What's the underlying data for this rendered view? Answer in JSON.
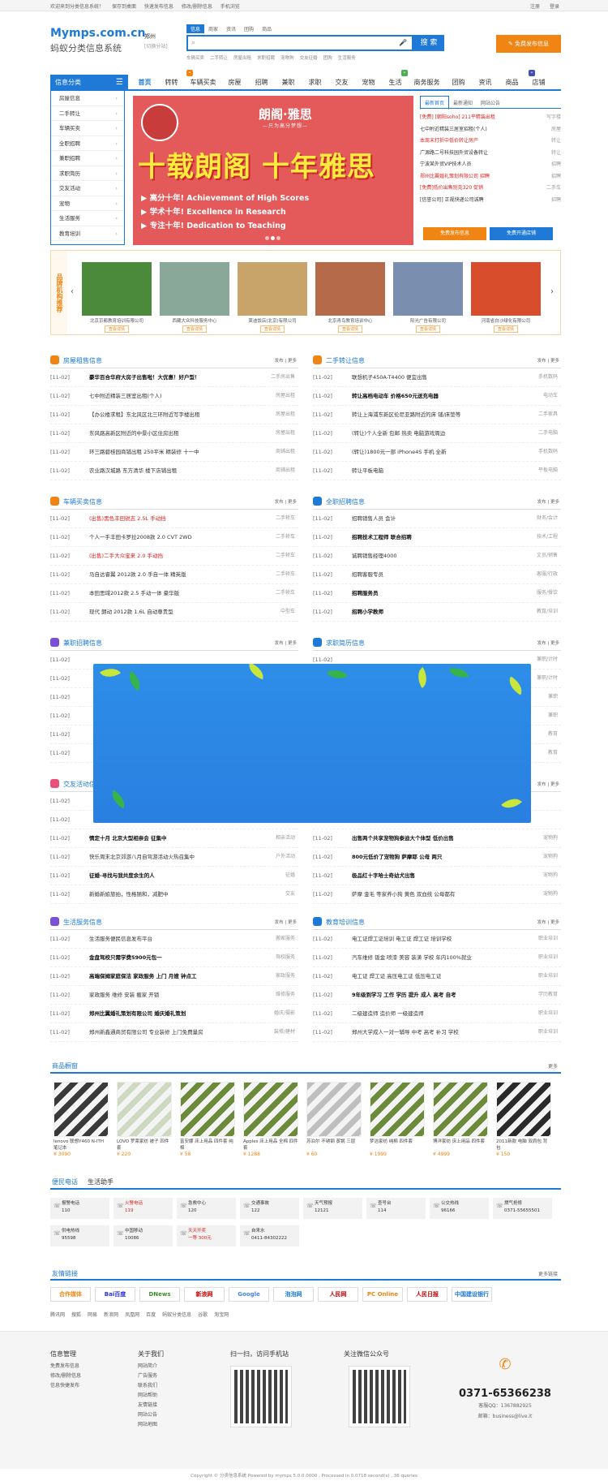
{
  "topbar": {
    "welcome": "欢迎来到分类信息系统！",
    "links": [
      "保存到桌面",
      "快速发布信息",
      "修改/删除信息",
      "手机浏览"
    ],
    "right": [
      "注册",
      "登录"
    ]
  },
  "header": {
    "logo_en": "Mymps.com.cn",
    "logo_cn": "蚂蚁分类信息系统",
    "city": "郑州",
    "city_switch": "[切换分站]",
    "search_tabs": [
      "信息",
      "商家",
      "资讯",
      "团购",
      "商品"
    ],
    "search_placeholder": "",
    "search_button": "搜 索",
    "hot": [
      "车辆买卖",
      "二手转让",
      "房屋出租",
      "求职招聘",
      "宠物狗",
      "交友征婚",
      "团购",
      "生活服务"
    ],
    "post_button": "免费发布信息"
  },
  "nav": {
    "category_title": "信息分类",
    "items": [
      "首页",
      "转转",
      "车辆买卖",
      "房屋",
      "招聘",
      "兼职",
      "求职",
      "交友",
      "宠物",
      "生活",
      "商务服务",
      "团购",
      "资讯",
      "商品",
      "店铺"
    ]
  },
  "side": [
    "房屋信息",
    "二手转让",
    "车辆买卖",
    "全职招聘",
    "兼职招聘",
    "求职简历",
    "交友活动",
    "宠物",
    "生活服务",
    "教育培训"
  ],
  "banner": {
    "brand": "朗阁·雅思",
    "motto": "—只为高分梦想—",
    "big": "十载朗阁 十年雅思",
    "lines": [
      "▶ 高分十年! Achievement of High Scores",
      "▶ 学术十年! Excellence in Research",
      "▶ 专注十年! Dedication to Teaching"
    ]
  },
  "news": {
    "tabs": [
      "最新首页",
      "最新通知",
      "网站公告"
    ],
    "items": [
      {
        "t": "[免费] [朝阳soho] 211平精装出租",
        "c": "写字楼",
        "red": true
      },
      {
        "t": "七中附近精装三居室招租(个人)",
        "c": "房屋",
        "red": false
      },
      {
        "t": "本周末打折中低价转让房产",
        "c": "转让",
        "red": true
      },
      {
        "t": "广源路二号科技园外贸设备转让",
        "c": "转让",
        "red": false
      },
      {
        "t": "宁波某外贸VIP技术人员",
        "c": "招聘",
        "red": false
      },
      {
        "t": "郑州比翼婚礼策划有限公司 招聘",
        "c": "招聘",
        "red": true
      },
      {
        "t": "[免费]低价出售别克320 促销",
        "c": "二手车",
        "red": true
      },
      {
        "t": "[信誉公司] 正规快递公司诚聘",
        "c": "招聘",
        "red": false
      }
    ],
    "btn1": "免费发布信息",
    "btn2": "免费开通店铺"
  },
  "brands": {
    "label": "品牌机构推荐",
    "items": [
      "北京京都教育培训有限公司",
      "西藏大众科技服务中心",
      "莱迪饭店(北京)有限公司",
      "北京青鸟教育培训中心",
      "阳光广告有限公司",
      "河南省白沙绿化有限公司"
    ],
    "btn": "查看详情"
  },
  "sections": [
    {
      "title": "房屋租售信息",
      "more": "发布 | 更多",
      "color": "#f08513",
      "rows": [
        [
          "[11-02]",
          "豪华百合华府大房子出售啦！大优惠！好户型！",
          "二手房出售",
          true,
          false
        ],
        [
          "[11-02]",
          "七中附近精装三居室出租(个人)",
          "房屋出租",
          false,
          false
        ],
        [
          "[11-02]",
          "【办公楼求租】东北风区北三环附近写字楼出租",
          "房屋出租",
          false,
          false
        ],
        [
          "[11-02]",
          "东风路高新区附近的中景小区住房出租",
          "房屋出租",
          false,
          false
        ],
        [
          "[11-02]",
          "环三路碧桂园商铺出租 250平米 精装修 十一中",
          "商铺出租",
          false,
          false
        ],
        [
          "[11-02]",
          "农业路汉城路 东方清华 楼下店铺出租",
          "商铺出租",
          false,
          false
        ]
      ]
    },
    {
      "title": "二手转让信息",
      "more": "发布 | 更多",
      "color": "#f08513",
      "rows": [
        [
          "[11-02]",
          "联想机子450A-T4400 便宜出售",
          "手机数码",
          false,
          false
        ],
        [
          "[11-02]",
          "转让高档电动车 价格650元送充电器",
          "电动车",
          true,
          true
        ],
        [
          "[11-02]",
          "转让上海浦东新区伦尼亚路附近的床 铺/床垫等",
          "二手家具",
          false,
          false
        ],
        [
          "[11-02]",
          "(转让)个人全新 包邮 热卖 电脑游戏周边",
          "二手电脑",
          false,
          false
        ],
        [
          "[11-02]",
          "(转让)1800元一部 iPhone4S 手机 全新",
          "手机数码",
          false,
          false
        ],
        [
          "[11-02]",
          "转让平板电脑",
          "平板电脑",
          false,
          false
        ]
      ]
    },
    {
      "title": "车辆买卖信息",
      "more": "发布 | 更多",
      "color": "#f08513",
      "rows": [
        [
          "[11-02]",
          "(出售)黑色丰田锐志 2.5L 手动挡",
          "二手轿车",
          false,
          true
        ],
        [
          "[11-02]",
          "个人一手丰田卡罗拉2008款 2.0 CVT 2WD",
          "二手轿车",
          false,
          false
        ],
        [
          "[11-02]",
          "(出售)二手大众宝来 2.0 手动挡",
          "二手轿车",
          false,
          true
        ],
        [
          "[11-02]",
          "马自达睿翼 2012款 2.0 手自一体 精英版",
          "二手轿车",
          false,
          false
        ],
        [
          "[11-02]",
          "本田思域2012款 2.5 手动一体 豪华版",
          "二手轿车",
          false,
          false
        ],
        [
          "[11-02]",
          "现代 朗动 2012款 1.6L 自动尊贵型",
          "中型车",
          false,
          false
        ]
      ]
    },
    {
      "title": "全职招聘信息",
      "more": "发布 | 更多",
      "color": "#1e7ad6",
      "rows": [
        [
          "[11-02]",
          "招聘销售人员 会计",
          "财务/会计",
          false,
          false
        ],
        [
          "[11-02]",
          "招聘技术工程师 联合招聘",
          "技术/工程",
          true,
          true
        ],
        [
          "[11-02]",
          "诚聘销售经理4000",
          "文员/销售",
          false,
          false
        ],
        [
          "[11-02]",
          "招聘客服专员",
          "客服/行政",
          false,
          false
        ],
        [
          "[11-02]",
          "招聘服务员",
          "服务/餐饮",
          true,
          true
        ],
        [
          "[11-02]",
          "招聘小学教师",
          "教育/培训",
          true,
          true
        ]
      ]
    },
    {
      "title": "兼职招聘信息",
      "more": "发布 | 更多",
      "color": "#7b4fd6",
      "rows": [
        [
          "[11-02]",
          "",
          "",
          false,
          false
        ],
        [
          "[11-02]",
          "",
          "",
          false,
          false
        ],
        [
          "[11-02]",
          "",
          "",
          false,
          false
        ],
        [
          "[11-02]",
          "",
          "",
          false,
          false
        ],
        [
          "[11-02]",
          "",
          "",
          false,
          false
        ],
        [
          "[11-02]",
          "",
          "",
          false,
          false
        ]
      ]
    },
    {
      "title": "求职简历信息",
      "more": "发布 | 更多",
      "color": "#1e7ad6",
      "rows": [
        [
          "[11-02]",
          "",
          "兼职/计时",
          false,
          false
        ],
        [
          "[11-02]",
          "",
          "兼职/计时",
          false,
          false
        ],
        [
          "[11-02]",
          "",
          "兼职",
          false,
          false
        ],
        [
          "[11-02]",
          "",
          "兼职",
          false,
          false
        ],
        [
          "[11-02]",
          "",
          "教育",
          false,
          false
        ],
        [
          "[11-02]",
          "",
          "教育",
          false,
          false
        ]
      ]
    },
    {
      "title": "交友活动信息",
      "more": "发布 | 更多",
      "color": "#e8507a",
      "rows": [
        [
          "[11-02]",
          "",
          "",
          false,
          false
        ],
        [
          "[11-02]",
          "",
          "",
          false,
          false
        ],
        [
          "[11-02]",
          "情定十月 北京大型相亲会 征集中",
          "相亲活动",
          true,
          false
        ],
        [
          "[11-02]",
          "快乐周末北京郊游八月自驾游活动火热召集中",
          "户外活动",
          false,
          false
        ],
        [
          "[11-02]",
          "征婚-寻找与我共度余生的人",
          "征婚",
          true,
          false
        ],
        [
          "[11-02]",
          "新婚新娘旅拍，性格随和，减肥中",
          "交友",
          false,
          false
        ]
      ]
    },
    {
      "title": "",
      "more": "发布 | 更多",
      "color": "#1e7ad6",
      "rows": [
        [
          "[11-02]",
          "",
          "",
          false,
          false
        ],
        [
          "[11-02]",
          "",
          "",
          false,
          false
        ],
        [
          "[11-02]",
          "出售两个共享宠物狗泰迪大个体型 低价出售",
          "宠物狗",
          true,
          true
        ],
        [
          "[11-02]",
          "800元低价了宠物狗 萨摩耶 公母 两只",
          "宠物狗",
          true,
          false
        ],
        [
          "[11-02]",
          "极品红十字哈士奇幼犬出售",
          "宠物狗",
          true,
          true
        ],
        [
          "[11-02]",
          "萨摩 金毛 等家养小狗 黄色 双血统 公母都有",
          "宠物狗",
          false,
          false
        ]
      ]
    },
    {
      "title": "生活服务信息",
      "more": "发布 | 更多",
      "color": "#7b4fd6",
      "rows": [
        [
          "[11-02]",
          "生活服务便民信息发布平台",
          "搬家服务",
          false,
          false
        ],
        [
          "[11-02]",
          "金盘驾校只需学费5900元包一",
          "驾校服务",
          true,
          false
        ],
        [
          "[11-02]",
          "高端保姆家庭保洁 家政服务 上门 月嫂 钟点工",
          "家政服务",
          true,
          false
        ],
        [
          "[11-02]",
          "家政服务 维修 安装 搬家 开锁",
          "维修服务",
          false,
          false
        ],
        [
          "[11-02]",
          "郑州比翼婚礼策划有限公司 婚庆婚礼策划",
          "婚庆/摄影",
          true,
          true
        ],
        [
          "[11-02]",
          "郑州新鑫通商贸有限公司 专业装修 上门免费量房",
          "装修/建材",
          false,
          false
        ]
      ]
    },
    {
      "title": "教育培训信息",
      "more": "发布 | 更多",
      "color": "#1e7ad6",
      "rows": [
        [
          "[11-02]",
          "电工证焊工证培训 电工证 焊工证 培训学校",
          "职业培训",
          false,
          false
        ],
        [
          "[11-02]",
          "汽车维修 钣金 喷漆 美容 装潢 学校 年内100%就业",
          "职业培训",
          false,
          false
        ],
        [
          "[11-02]",
          "电工证 焊工证 高压电工证 低压电工证",
          "职业培训",
          false,
          false
        ],
        [
          "[11-02]",
          "9年级到学习 工作 学历 提升 成人 高考 自考",
          "学历教育",
          true,
          false
        ],
        [
          "[11-02]",
          "二级建造师 造价师 一级建造师",
          "职业培训",
          false,
          false
        ],
        [
          "[11-02]",
          "郑州大学成人一对一辅导 中考 高考 补习 学校",
          "职业培训",
          false,
          false
        ]
      ]
    }
  ],
  "goods": {
    "title": "商品橱窗",
    "more": "更多",
    "items": [
      {
        "n": "lenovo 联想Y460 N-ITH 笔记本",
        "p": "¥ 3090"
      },
      {
        "n": "LOVO 罗莱家纺 被子 四件套",
        "p": "¥ 220"
      },
      {
        "n": "富安娜 床上用品 四件套 纯棉",
        "p": "¥ 58"
      },
      {
        "n": "Apples 床上用品 全棉 四件套",
        "p": "¥ 1288"
      },
      {
        "n": "苏泊尔 不锈钢 蒸锅 三层",
        "p": "¥ 60"
      },
      {
        "n": "梦洁家纺 纯棉 四件套",
        "p": "¥ 1999"
      },
      {
        "n": "博洋家纺 床上用品 四件套",
        "p": "¥ 4999"
      },
      {
        "n": "2011新款 电脑 双肩包 背包",
        "p": "¥ 150"
      }
    ]
  },
  "contacts": {
    "tabs": [
      "便民电话",
      "生活助手"
    ],
    "items": [
      {
        "a": "报警电话",
        "b": "110"
      },
      {
        "a": "火警电话",
        "b": "119"
      },
      {
        "a": "急救中心",
        "b": "120"
      },
      {
        "a": "交通事故",
        "b": "122"
      },
      {
        "a": "天气预报",
        "b": "12121"
      },
      {
        "a": "查号台",
        "b": "114"
      },
      {
        "a": "公交热线",
        "b": "96166"
      },
      {
        "a": "燃气抢修",
        "b": "0371-55655501"
      },
      {
        "a": "供电热线",
        "b": "95598"
      },
      {
        "a": "中国移动",
        "b": "10086"
      },
      {
        "a": "天天开奖",
        "b": "一等 300元"
      },
      {
        "a": "自来水",
        "b": "0411-84302222"
      }
    ]
  },
  "links": {
    "title": "友情链接",
    "more": "更多链接",
    "logos": [
      "合作媒体",
      "Bai百度",
      "DNews",
      "新浪网",
      "Google",
      "泡泡网",
      "人民网",
      "PC Online",
      "人民日报",
      "中国建设银行"
    ],
    "text": [
      "腾讯网",
      "搜狐",
      "网易",
      "新浪网",
      "凤凰网",
      "百度",
      "蚂蚁分类信息",
      "谷歌",
      "淘宝网"
    ]
  },
  "footer": {
    "col1": {
      "h": "信息管理",
      "items": [
        "免费发布信息",
        "修改/删除信息",
        "信息快捷发布"
      ]
    },
    "col2": {
      "h": "关于我们",
      "items": [
        "网站简介",
        "广告服务",
        "联系我们",
        "网站帮助",
        "友情链接",
        "网站公告",
        "网站地图"
      ]
    },
    "qr1": "扫一扫，访问手机站",
    "qr2": "关注微信公众号",
    "phone": "0371-65366238",
    "qq": "客服QQ：1367882925",
    "email": "邮箱：business@live.it"
  },
  "copyright": "Copyright © 分类信息系统 Powered by mymps 5.0.0.0000 , Processed in 0.0718 second(s) , 36 queries"
}
